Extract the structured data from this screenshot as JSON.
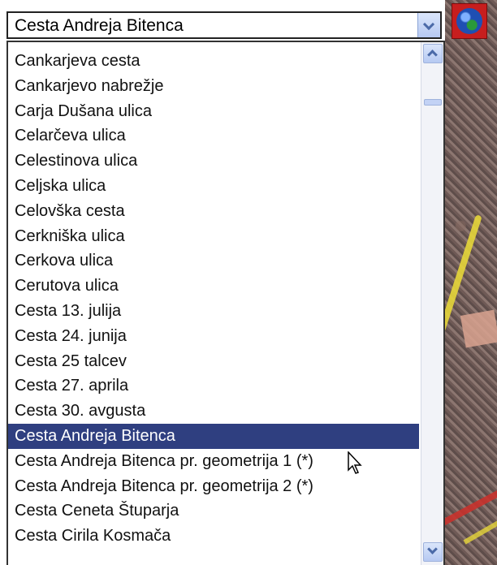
{
  "combo": {
    "selected_value": "Cesta Andreja Bitenca"
  },
  "list": {
    "items": [
      "Cankarjeva cesta",
      "Cankarjevo nabrežje",
      "Carja Dušana ulica",
      "Celarčeva ulica",
      "Celestinova ulica",
      "Celjska ulica",
      "Celovška cesta",
      "Cerkniška ulica",
      "Cerkova ulica",
      "Cerutova ulica",
      "Cesta 13. julija",
      "Cesta 24. junija",
      "Cesta 25 talcev",
      "Cesta 27. aprila",
      "Cesta 30. avgusta",
      "Cesta Andreja Bitenca",
      "Cesta Andreja Bitenca pr. geometrija 1 (*)",
      "Cesta Andreja Bitenca pr. geometrija 2 (*)",
      "Cesta Ceneta Štuparja",
      "Cesta Cirila Kosmača"
    ],
    "selected_index": 15
  },
  "icons": {
    "dropdown_arrow": "chevron-down-icon",
    "scroll_up": "chevron-up-icon",
    "scroll_down": "chevron-down-icon",
    "globe": "globe-icon",
    "cursor": "mouse-pointer-icon"
  },
  "colors": {
    "selection": "#2f3f80",
    "globe_button": "#c71e1e",
    "road_yellow": "#e6d63a",
    "road_red": "#c8322c"
  }
}
